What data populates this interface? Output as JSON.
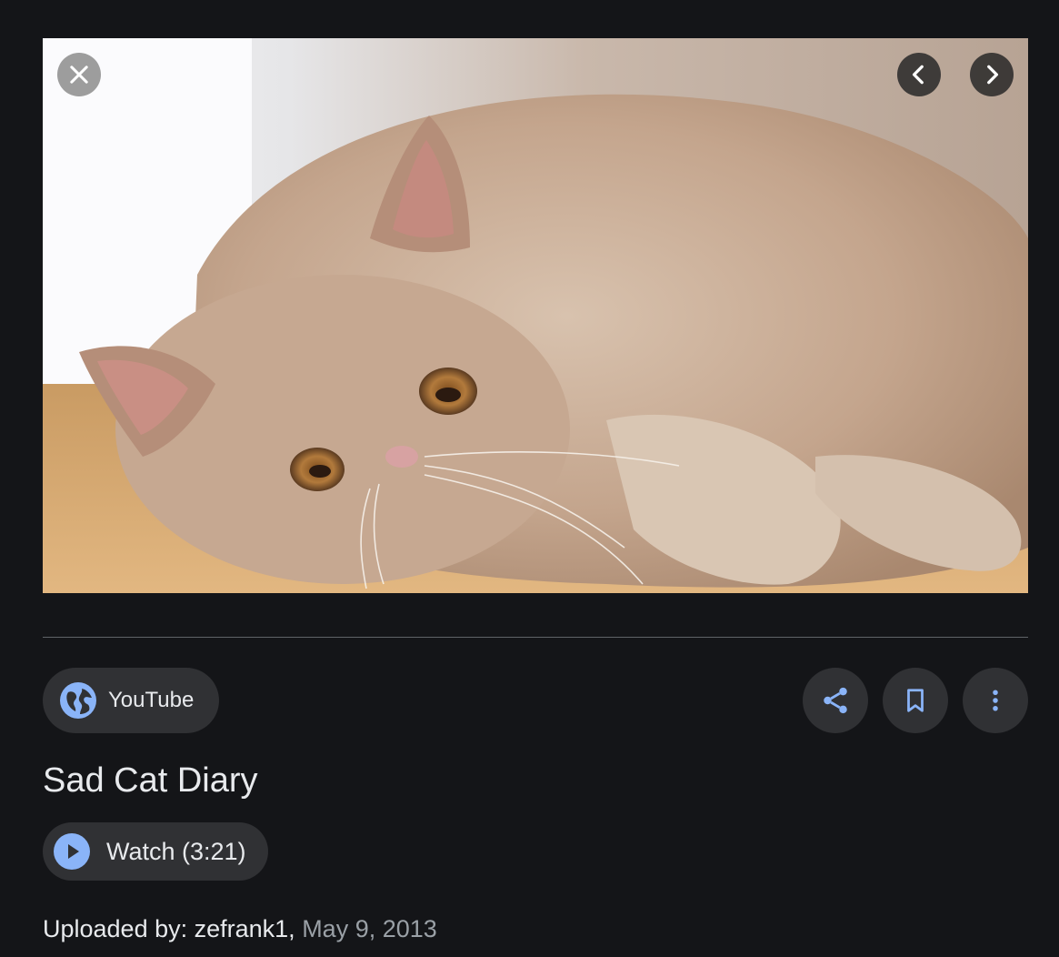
{
  "viewer": {
    "image_alt": "Cat lying on wooden floor"
  },
  "controls": {
    "close_icon": "close-icon",
    "prev_icon": "chevron-left-icon",
    "next_icon": "chevron-right-icon"
  },
  "source": {
    "label": "YouTube",
    "icon": "globe-icon"
  },
  "actions": {
    "share_icon": "share-icon",
    "save_icon": "bookmark-icon",
    "more_icon": "more-vertical-icon"
  },
  "title": "Sad Cat Diary",
  "watch": {
    "label": "Watch (3:21)",
    "icon": "play-icon"
  },
  "meta": {
    "uploaded_prefix": "Uploaded by: zefrank1, ",
    "date": "May 9, 2013"
  },
  "colors": {
    "background": "#141518",
    "chip": "#303134",
    "accent": "#8ab4f8",
    "text": "#e8eaed",
    "muted": "#9aa0a6"
  }
}
